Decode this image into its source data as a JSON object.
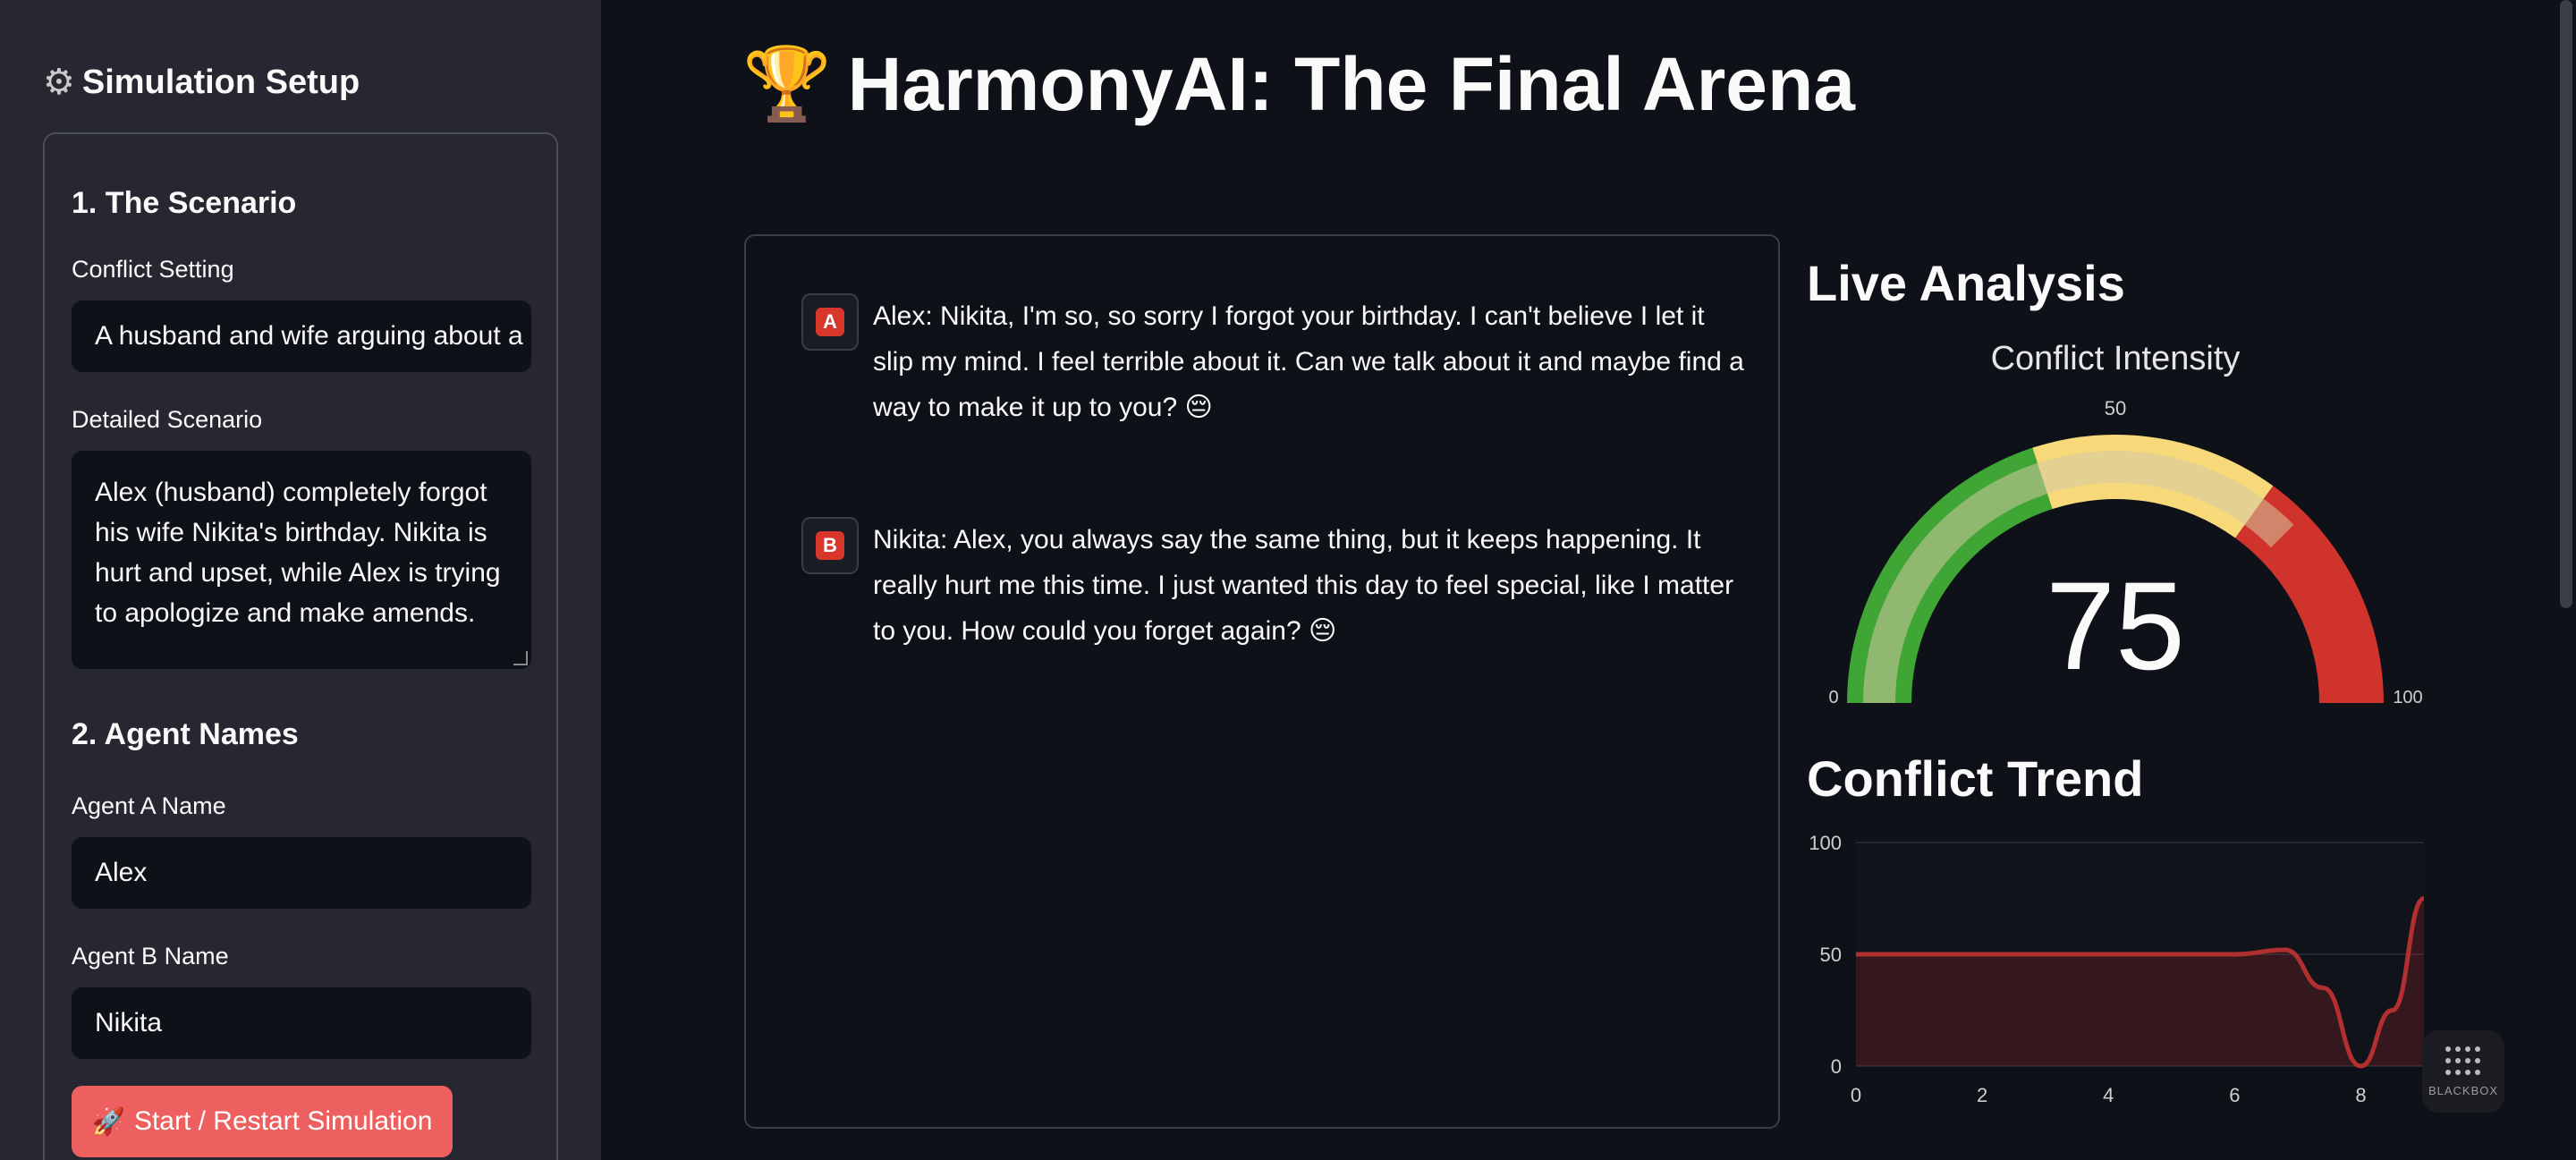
{
  "sidebar": {
    "icon": "gear-icon",
    "title": "Simulation Setup",
    "section1_heading": "1. The Scenario",
    "conflict_setting_label": "Conflict Setting",
    "conflict_setting_value": "A husband and wife arguing about a",
    "detailed_scenario_label": "Detailed Scenario",
    "detailed_scenario_value": "Alex (husband) completely forgot his wife Nikita's birthday. Nikita is hurt and upset, while Alex is trying to apologize and make amends.",
    "section2_heading": "2. Agent Names",
    "agent_a_label": "Agent A Name",
    "agent_a_value": "Alex",
    "agent_b_label": "Agent B Name",
    "agent_b_value": "Nikita",
    "start_button_icon": "rocket-icon",
    "start_button_label": "Start / Restart Simulation"
  },
  "header": {
    "icon": "trophy-icon",
    "title": "HarmonyAI: The Final Arena"
  },
  "chat": {
    "messages": [
      {
        "avatar": "A",
        "text": "Alex: Nikita, I'm so, so sorry I forgot your birthday. I can't believe I let it slip my mind. I feel terrible about it. Can we talk about it and maybe find a way to make it up to you? 😔"
      },
      {
        "avatar": "B",
        "text": "Nikita: Alex, you always say the same thing, but it keeps happening. It really hurt me this time. I just wanted this day to feel special, like I matter to you. How could you forget again? 😔"
      }
    ]
  },
  "analysis": {
    "heading": "Live Analysis",
    "gauge_title": "Conflict Intensity",
    "gauge_value": "75",
    "gauge_min_label": "0",
    "gauge_mid_label": "50",
    "gauge_max_label": "100",
    "gauge_fraction": 0.75,
    "colors": {
      "green": "#3fa535",
      "yellow": "#f7d97a",
      "red": "#d0332b",
      "bar": "#d6c8a2"
    }
  },
  "trend": {
    "heading": "Conflict Trend"
  },
  "chart_data": {
    "type": "area",
    "x": [
      0,
      1,
      2,
      3,
      4,
      5,
      6,
      6.8,
      7.4,
      8,
      8.5,
      9
    ],
    "y": [
      50,
      50,
      50,
      50,
      50,
      50,
      50,
      52,
      35,
      0,
      25,
      75
    ],
    "xlim": [
      0,
      9
    ],
    "ylim": [
      0,
      100
    ],
    "xticks": [
      0,
      2,
      4,
      6,
      8
    ],
    "yticks": [
      0,
      50,
      100
    ],
    "color": "#b22f2f",
    "grid": true
  },
  "brand": {
    "label": "BLACKBOX",
    "icon": "blackbox-logo-icon"
  }
}
